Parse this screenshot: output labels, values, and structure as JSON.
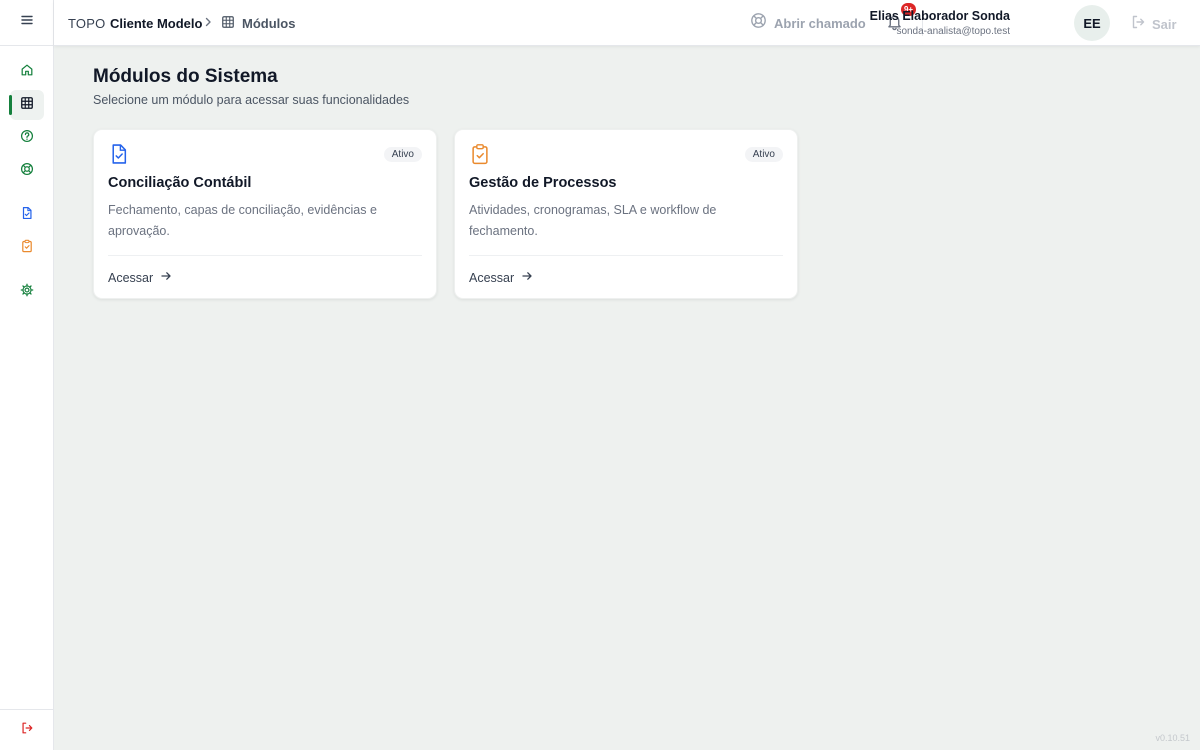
{
  "header": {
    "brand": "TOPO",
    "client": "Cliente Modelo",
    "current_page": "Módulos",
    "open_ticket_label": "Abrir chamado",
    "notification_badge": "9+",
    "user_name": "Elias Elaborador Sonda",
    "user_email": "sonda-analista@topo.test",
    "avatar_initials": "EE",
    "logout_label": "Sair"
  },
  "sidebar": {
    "items": [
      {
        "name": "home-icon",
        "active": false
      },
      {
        "name": "grid-icon",
        "active": true
      },
      {
        "name": "help-circle-icon",
        "active": false
      },
      {
        "name": "lifebuoy-icon",
        "active": false
      },
      {
        "name": "file-check-icon",
        "active": false
      },
      {
        "name": "clipboard-check-icon",
        "active": false
      },
      {
        "name": "gear-icon",
        "active": false
      }
    ]
  },
  "main": {
    "title": "Módulos do Sistema",
    "subtitle": "Selecione um módulo para acessar suas funcionalidades",
    "cards": [
      {
        "icon": "file-check-icon",
        "status": "Ativo",
        "title": "Conciliação Contábil",
        "description": "Fechamento, capas de conciliação, evidências e aprovação.",
        "action": "Acessar"
      },
      {
        "icon": "clipboard-check-icon",
        "status": "Ativo",
        "title": "Gestão de Processos",
        "description": "Atividades, cronogramas, SLA e workflow de fechamento.",
        "action": "Acessar"
      }
    ]
  },
  "footer": {
    "version": "v0.10.51"
  },
  "colors": {
    "accent_green": "#15803d",
    "accent_blue": "#2563eb",
    "accent_orange": "#ea8a2e",
    "badge_red": "#dc2626",
    "background": "#eef1ef"
  }
}
